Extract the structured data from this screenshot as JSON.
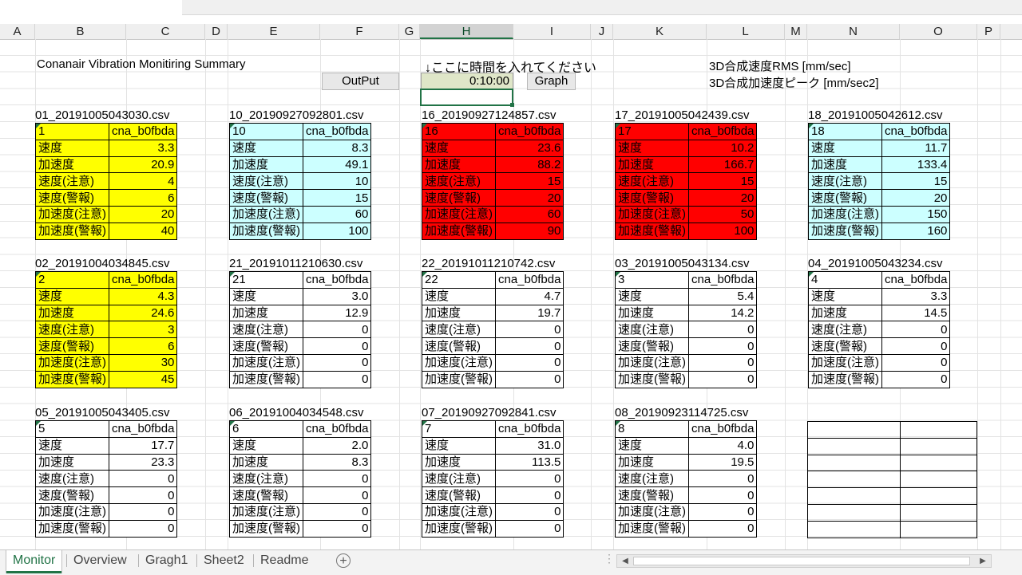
{
  "columns": [
    "A",
    "B",
    "C",
    "D",
    "E",
    "F",
    "G",
    "H",
    "I",
    "J",
    "K",
    "L",
    "M",
    "N",
    "O",
    "P"
  ],
  "selected_column": "H",
  "title": "Conanair Vibration Monitiring Summary",
  "note": "↓ここに時間を入れてください",
  "time_value": "0:10:00",
  "buttons": {
    "output": "OutPut",
    "graph": "Graph"
  },
  "legend": {
    "rms": "3D合成速度RMS  [mm/sec]",
    "peak": "3D合成加速度ピーク [mm/sec2]"
  },
  "row_labels": [
    "速度",
    "加速度",
    "速度(注意)",
    "速度(警報)",
    "加速度(注意)",
    "加速度(警報)"
  ],
  "blocks": [
    {
      "file": "01_20191005043030.csv",
      "id": "1",
      "device": "cna_b0fbda",
      "color": "yellow",
      "values": [
        "3.3",
        "20.9",
        "4",
        "6",
        "20",
        "40"
      ]
    },
    {
      "file": "10_20190927092801.csv",
      "id": "10",
      "device": "cna_b0fbda",
      "color": "cyan",
      "values": [
        "8.3",
        "49.1",
        "10",
        "15",
        "60",
        "100"
      ]
    },
    {
      "file": "16_20190927124857.csv",
      "id": "16",
      "device": "cna_b0fbda",
      "color": "red",
      "values": [
        "23.6",
        "88.2",
        "15",
        "20",
        "60",
        "90"
      ]
    },
    {
      "file": "17_20191005042439.csv",
      "id": "17",
      "device": "cna_b0fbda",
      "color": "red",
      "values": [
        "10.2",
        "166.7",
        "15",
        "20",
        "50",
        "100"
      ]
    },
    {
      "file": "18_20191005042612.csv",
      "id": "18",
      "device": "cna_b0fbda",
      "color": "cyan",
      "values": [
        "11.7",
        "133.4",
        "15",
        "20",
        "150",
        "160"
      ]
    },
    {
      "file": "02_20191004034845.csv",
      "id": "2",
      "device": "cna_b0fbda",
      "color": "yellow",
      "values": [
        "4.3",
        "24.6",
        "3",
        "6",
        "30",
        "45"
      ]
    },
    {
      "file": "21_20191011210630.csv",
      "id": "21",
      "device": "cna_b0fbda",
      "color": "white",
      "values": [
        "3.0",
        "12.9",
        "0",
        "0",
        "0",
        "0"
      ]
    },
    {
      "file": "22_20191011210742.csv",
      "id": "22",
      "device": "cna_b0fbda",
      "color": "white",
      "values": [
        "4.7",
        "19.7",
        "0",
        "0",
        "0",
        "0"
      ]
    },
    {
      "file": "03_20191005043134.csv",
      "id": "3",
      "device": "cna_b0fbda",
      "color": "white",
      "values": [
        "5.4",
        "14.2",
        "0",
        "0",
        "0",
        "0"
      ]
    },
    {
      "file": "04_20191005043234.csv",
      "id": "4",
      "device": "cna_b0fbda",
      "color": "white",
      "values": [
        "3.3",
        "14.5",
        "0",
        "0",
        "0",
        "0"
      ]
    },
    {
      "file": "05_20191005043405.csv",
      "id": "5",
      "device": "cna_b0fbda",
      "color": "white",
      "values": [
        "17.7",
        "23.3",
        "0",
        "0",
        "0",
        "0"
      ]
    },
    {
      "file": "06_20191004034548.csv",
      "id": "6",
      "device": "cna_b0fbda",
      "color": "white",
      "values": [
        "2.0",
        "8.3",
        "0",
        "0",
        "0",
        "0"
      ]
    },
    {
      "file": "07_20190927092841.csv",
      "id": "7",
      "device": "cna_b0fbda",
      "color": "white",
      "values": [
        "31.0",
        "113.5",
        "0",
        "0",
        "0",
        "0"
      ]
    },
    {
      "file": "08_20190923114725.csv",
      "id": "8",
      "device": "cna_b0fbda",
      "color": "white",
      "values": [
        "4.0",
        "19.5",
        "0",
        "0",
        "0",
        "0"
      ]
    }
  ],
  "sheet_tabs": [
    "Monitor",
    "Overview",
    "Gragh1",
    "Sheet2",
    "Readme"
  ],
  "active_tab": "Monitor",
  "colors": {
    "accent": "#217346",
    "yellow": "#ffff00",
    "cyan": "#ccffff",
    "red": "#ff0000",
    "time_cell": "#dfe6c8"
  }
}
